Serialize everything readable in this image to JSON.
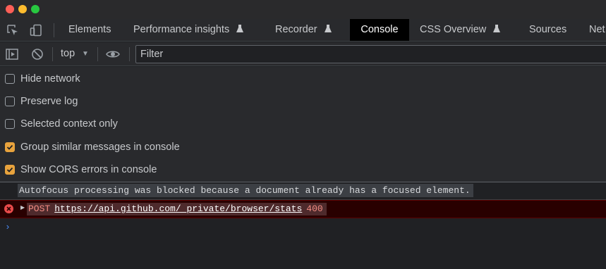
{
  "window": {
    "traffic_lights": [
      "close",
      "minimize",
      "zoom"
    ]
  },
  "tabs": {
    "tool_icons": [
      "inspect-element-icon",
      "device-toolbar-icon"
    ],
    "items": [
      {
        "label": "Elements",
        "experimental": false,
        "active": false
      },
      {
        "label": "Performance insights",
        "experimental": true,
        "active": false
      },
      {
        "label": "Recorder",
        "experimental": true,
        "active": false
      },
      {
        "label": "Console",
        "experimental": false,
        "active": true
      },
      {
        "label": "CSS Overview",
        "experimental": true,
        "active": false
      },
      {
        "label": "Sources",
        "experimental": false,
        "active": false
      },
      {
        "label": "Net",
        "experimental": false,
        "active": false
      }
    ]
  },
  "toolbar": {
    "context": "top",
    "filter_placeholder": "Filter",
    "icons": [
      "sidebar-toggle-icon",
      "clear-console-icon",
      "dropdown-caret-icon",
      "live-expression-eye-icon"
    ]
  },
  "settings": [
    {
      "label": "Hide network",
      "checked": false
    },
    {
      "label": "Preserve log",
      "checked": false
    },
    {
      "label": "Selected context only",
      "checked": false
    },
    {
      "label": "Group similar messages in console",
      "checked": true
    },
    {
      "label": "Show CORS errors in console",
      "checked": true
    }
  ],
  "messages": {
    "info": "Autofocus processing was blocked because a document already has a focused element.",
    "error": {
      "method": "POST",
      "url": "https://api.github.com/_private/browser/stats",
      "status": "400"
    },
    "prompt": "›"
  },
  "colors": {
    "accent_checkbox": "#e8a33d",
    "error_red": "#e94b4b",
    "prompt_blue": "#4a8af4"
  }
}
